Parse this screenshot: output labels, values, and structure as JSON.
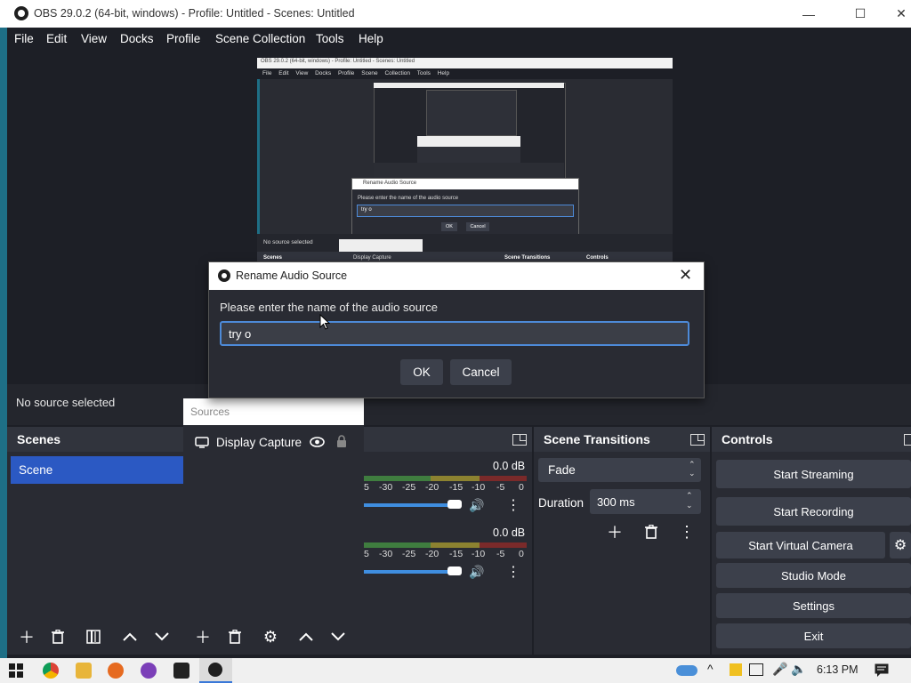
{
  "window": {
    "title": "OBS 29.0.2 (64-bit, windows) - Profile: Untitled - Scenes: Untitled",
    "min": "—",
    "max": "☐",
    "close": "✕"
  },
  "menu": [
    "File",
    "Edit",
    "View",
    "Docks",
    "Profile",
    "Scene Collection",
    "Tools",
    "Help"
  ],
  "nested_preview": {
    "title": "OBS 29.0.2 (64-bit, windows) - Profile: Untitled - Scenes: Untitled",
    "menu": [
      "File",
      "Edit",
      "View",
      "Docks",
      "Profile",
      "Scene Collection",
      "Tools",
      "Help"
    ],
    "dialog_title": "Rename Audio Source",
    "dialog_prompt": "Please enter the name of the audio source",
    "dialog_value": "try o",
    "ok": "OK",
    "cancel": "Cancel",
    "status": "No source selected",
    "scenes": "Scenes",
    "display_capture": "Display Capture",
    "scene_transitions": "Scene Transitions",
    "controls": "Controls"
  },
  "dialog": {
    "title": "Rename Audio Source",
    "prompt": "Please enter the name of the audio source",
    "value": "try o",
    "ok": "OK",
    "cancel": "Cancel"
  },
  "status": {
    "text": "No source selected"
  },
  "scenes": {
    "title": "Scenes",
    "items": [
      "Scene"
    ]
  },
  "sources": {
    "title": "Sources",
    "items": [
      {
        "label": "Display Capture"
      }
    ]
  },
  "mixer": {
    "channels": [
      {
        "db": "0.0 dB",
        "ticks": [
          "5",
          "-30",
          "-25",
          "-20",
          "-15",
          "-10",
          "-5",
          "0"
        ]
      },
      {
        "db": "0.0 dB",
        "ticks": [
          "5",
          "-30",
          "-25",
          "-20",
          "-15",
          "-10",
          "-5",
          "0"
        ]
      }
    ]
  },
  "transitions": {
    "title": "Scene Transitions",
    "type": "Fade",
    "duration_label": "Duration",
    "duration_value": "300 ms"
  },
  "controls": {
    "title": "Controls",
    "buttons": [
      "Start Streaming",
      "Start Recording",
      "Start Virtual Camera",
      "Studio Mode",
      "Settings",
      "Exit"
    ]
  },
  "taskbar": {
    "time": "6:13 PM"
  },
  "colors": {
    "accent": "#2b59c3",
    "dialog_border": "#4d8ad8",
    "meter_green": "#4caf50",
    "meter_yellow": "#c8b432",
    "meter_red": "#c03a3a"
  }
}
